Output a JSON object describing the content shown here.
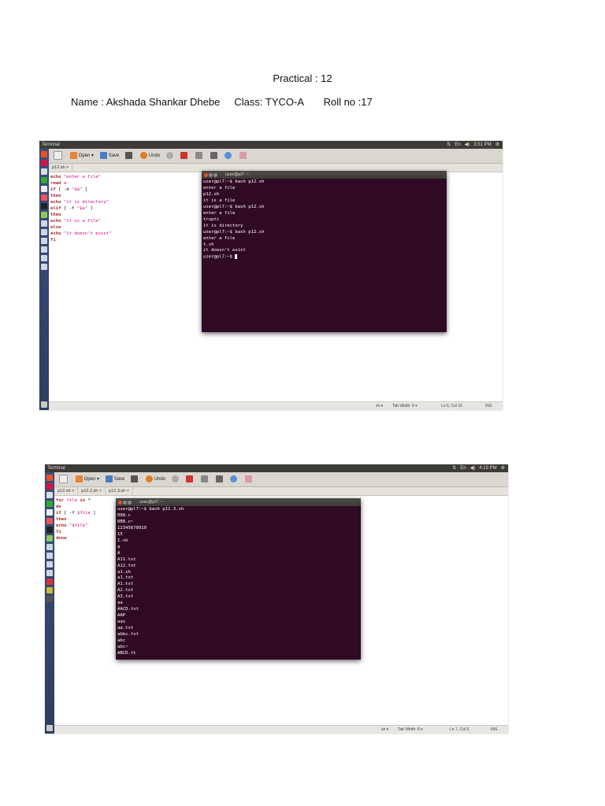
{
  "document": {
    "title": "Practical : 12",
    "info": "Name : Akshada Shankar Dhebe     Class: TYCO-A       Roll no :17"
  },
  "screenshots": [
    {
      "topbar": {
        "app": "Terminal",
        "clock": "3:51 PM",
        "keyboard": "En"
      },
      "toolbar": {
        "open": "Open",
        "save": "Save",
        "undo": "Undo"
      },
      "tabs": [
        "p12.sh ×"
      ],
      "code": [
        [
          [
            "kw",
            "echo "
          ],
          [
            "str",
            "\"enter a file\""
          ]
        ],
        [
          [
            "kw",
            "read "
          ],
          [
            "str",
            "a"
          ]
        ],
        [
          [
            "kw",
            "if "
          ],
          [
            "",
            "[ -d "
          ],
          [
            "str",
            "\"$a\""
          ],
          [
            "",
            " ]"
          ]
        ],
        [
          [
            "kw",
            "then"
          ]
        ],
        [
          [
            "kw",
            "echo "
          ],
          [
            "str",
            "\"it is directory\""
          ]
        ],
        [
          [
            "kw",
            "elif "
          ],
          [
            "",
            "[ -f "
          ],
          [
            "str",
            "\"$a\""
          ],
          [
            "",
            " ]"
          ]
        ],
        [
          [
            "kw",
            "then"
          ]
        ],
        [
          [
            "kw",
            "echo "
          ],
          [
            "str",
            "\"it is a file\""
          ]
        ],
        [
          [
            "kw",
            "else"
          ]
        ],
        [
          [
            "kw",
            "echo "
          ],
          [
            "str",
            "\"it doesn't exist\""
          ]
        ],
        [
          [
            "kw",
            "fi"
          ]
        ]
      ],
      "terminal": {
        "title": "user@pl7: ~",
        "lines": [
          "user@pl7:~$ bash p12.sh",
          "enter a file",
          "p12.sh",
          "it is a file",
          "user@pl7:~$ bash p12.sh",
          "enter a file",
          "trupti",
          "it is directory",
          "user@pl7:~$ bash p12.sh",
          "enter a file",
          "t.sh",
          "it doesn't exist",
          "user@pl7:~$ "
        ]
      },
      "status": {
        "lang": "sh ▾",
        "tab_width": "Tab Width: 8 ▾",
        "position": "Ln 6, Col 16",
        "mode": "INS"
      }
    },
    {
      "topbar": {
        "app": "Terminal",
        "clock": "4:19 PM",
        "keyboard": "En"
      },
      "toolbar": {
        "open": "Open",
        "save": "Save",
        "undo": "Undo"
      },
      "tabs": [
        "p12.sh ×",
        "p12.2.sh ×",
        "p12.3.sh ×"
      ],
      "code": [
        [
          [
            "kw",
            "for "
          ],
          [
            "str",
            "file "
          ],
          [
            "kw",
            "in "
          ],
          [
            "",
            "*"
          ]
        ],
        [
          [
            "kw",
            "do"
          ]
        ],
        [
          [
            "kw",
            "if "
          ],
          [
            "",
            "[ -f "
          ],
          [
            "str",
            "$file"
          ],
          [
            "",
            " ]"
          ]
        ],
        [
          [
            "kw",
            "then"
          ]
        ],
        [
          [
            "kw",
            "echo "
          ],
          [
            "str",
            "\"$file\""
          ]
        ],
        [
          [
            "kw",
            "fi"
          ]
        ],
        [
          [
            "kw",
            "done"
          ]
        ]
      ],
      "terminal": {
        "title": "user@pl7: ~",
        "lines": [
          "user@pl7:~$ bash p12.3.sh",
          "088.c",
          "0B8.c~",
          "12345678910",
          "15",
          "1.sh",
          "a",
          "A",
          "A11.txt",
          "A12.txt",
          "a1.sh",
          "a1.txt",
          "A1.txt",
          "A2.txt",
          "A3.txt",
          "aa",
          "AACD.txt",
          "AAP",
          "aas",
          "aa.txt",
          "abbc.txt",
          "abc",
          "abc~",
          "ABCD.tt"
        ]
      },
      "status": {
        "lang": "sh ▾",
        "tab_width": "Tab Width: 8 ▾",
        "position": "Ln 7, Col 5",
        "mode": "INS"
      }
    }
  ]
}
